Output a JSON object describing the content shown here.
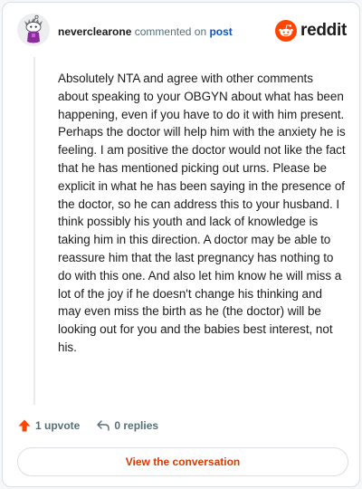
{
  "header": {
    "username": "neverclearone",
    "action_text": "commented on",
    "post_link": "post",
    "brand_word": "reddit"
  },
  "comment": {
    "body": "Absolutely NTA and agree with other comments about speaking to your OBGYN about what has been happening, even if you have to do it with him present. Perhaps the doctor will help him with the anxiety he is feeling. I am positive the doctor would not like the fact that he has mentioned picking out urns. Please be explicit in what he has been saying in the presence of the doctor, so he can address this to your husband. I think possibly his youth and lack of knowledge is taking him in this direction. A doctor may be able to reassure him that the last pregnancy has nothing to do with this one. And also let him know he will miss a lot of the joy if he doesn't change his thinking and may even miss the birth as he (the doctor) will be looking out for you and the babies best interest, not his."
  },
  "actions": {
    "upvote_label": "1 upvote",
    "replies_label": "0 replies"
  },
  "footer": {
    "view_button": "View the conversation"
  },
  "icons": {
    "avatar": "snoo-avatar-icon",
    "brand": "reddit-logo-icon",
    "upvote": "upvote-arrow-icon",
    "reply": "reply-arrow-icon"
  },
  "colors": {
    "brand_orange": "#ff4500",
    "link_blue": "#0b53c9",
    "button_text": "#d93a00",
    "muted_text": "#576f76"
  }
}
